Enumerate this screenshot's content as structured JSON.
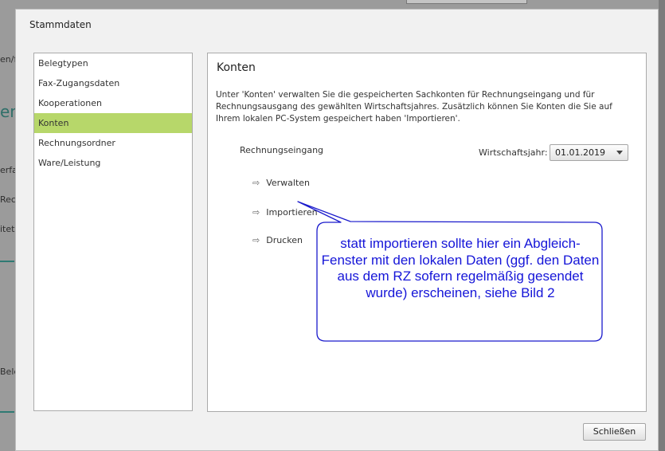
{
  "background": {
    "fragments": [
      "en/f",
      "en",
      "erfa",
      "Rech",
      "itete",
      "Bele"
    ]
  },
  "dialog": {
    "title": "Stammdaten",
    "nav": {
      "items": [
        "Belegtypen",
        "Fax-Zugangsdaten",
        "Kooperationen",
        "Konten",
        "Rechnungsordner",
        "Ware/Leistung"
      ],
      "active": "Konten"
    },
    "content": {
      "title": "Konten",
      "description": "Unter 'Konten' verwalten Sie die gespeicherten Sachkonten für Rechnungseingang und für Rechnungsausgang des gewählten Wirtschaftsjahres. Zusätzlich können Sie Konten die Sie auf Ihrem lokalen PC-System gespeichert haben 'Importieren'.",
      "section_label": "Rechnungseingang",
      "wirtschaftsjahr_label": "Wirtschaftsjahr:",
      "wirtschaftsjahr_value": "01.01.2019",
      "actions": [
        "Verwalten",
        "Importieren",
        "Drucken"
      ]
    },
    "close_label": "Schließen"
  },
  "annotation": {
    "text": "statt importieren sollte hier ein Abgleich-Fenster mit den lokalen Daten (ggf. den Daten aus dem RZ sofern regelmäßig gesendet wurde) erscheinen, siehe Bild 2",
    "color": "#1515d8"
  },
  "colors": {
    "active_nav": "#b7d76a",
    "dialog_bg": "#f1f1f1"
  }
}
